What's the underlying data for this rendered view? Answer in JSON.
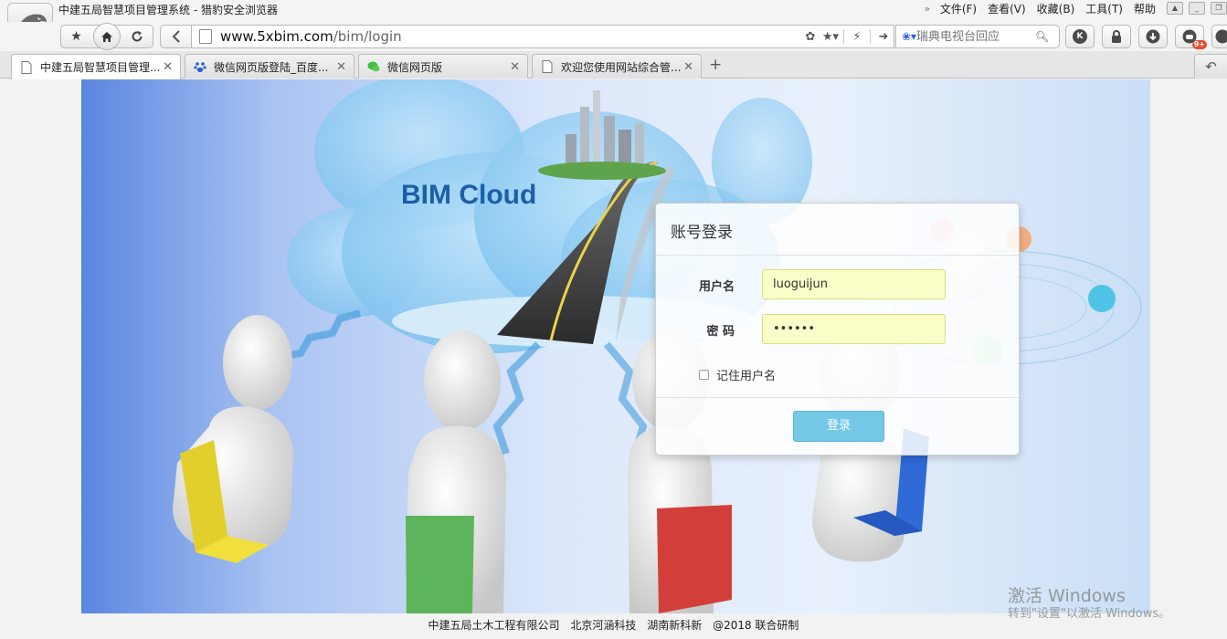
{
  "window": {
    "title": "中建五局智慧项目管理系统 - 猎豹安全浏览器",
    "menu": [
      "文件(F)",
      "查看(V)",
      "收藏(B)",
      "工具(T)",
      "帮助"
    ]
  },
  "toolbar": {
    "url_host": "www.5xbim.com",
    "url_path": "/bim/login",
    "search_placeholder": "瑞典电视台回应",
    "badge": "9+",
    "k_icon": "K"
  },
  "tabs": [
    {
      "label": "中建五局智慧项目管理...",
      "icon": "page-icon",
      "active": true
    },
    {
      "label": "微信网页版登陆_百度...",
      "icon": "baidu-paw-icon",
      "active": false
    },
    {
      "label": "微信网页版",
      "icon": "wechat-icon",
      "active": false
    },
    {
      "label": "欢迎您使用网站综合管...",
      "icon": "page-icon",
      "active": false
    }
  ],
  "banner": {
    "text": "BIM Cloud"
  },
  "login": {
    "title": "账号登录",
    "username_label": "用户名",
    "username_value": "luoguijun",
    "password_label": "密 码",
    "password_value": "••••••",
    "remember_label": "记住用户名",
    "submit_label": "登录"
  },
  "footer": {
    "items": [
      "中建五局土木工程有限公司",
      "北京河涵科技",
      "湖南新科新",
      "@2018 联合研制"
    ]
  },
  "watermark": {
    "line1": "激活 Windows",
    "line2": "转到\"设置\"以激活 Windows。"
  },
  "colors": {
    "login_button": "#74c8e6",
    "input_background": "#fafdc7",
    "bim_text": "#1e5ea8"
  }
}
